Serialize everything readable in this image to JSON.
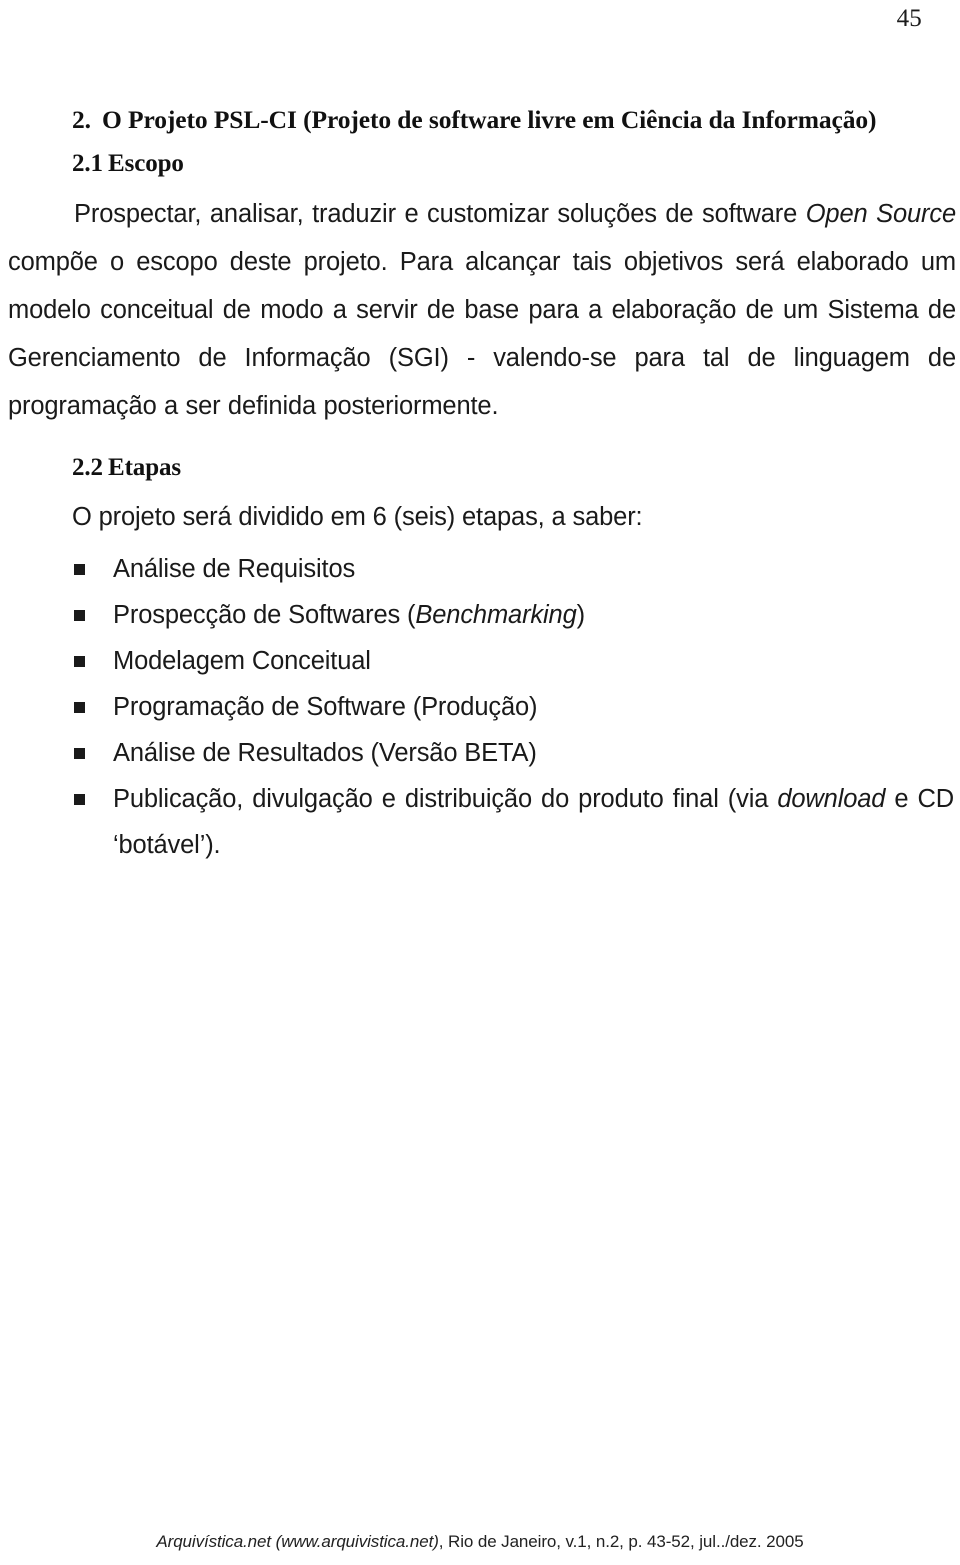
{
  "document": {
    "page_number": "45",
    "section": {
      "number": "2.",
      "title": "O Projeto PSL-CI (Projeto de software livre em Ciência da Informação)"
    },
    "subsection_escopo": {
      "number": "2.1",
      "title": "Escopo",
      "paragraph": {
        "part1": "Prospectar, analisar, traduzir e customizar soluções de software ",
        "italic1": "Open Source",
        "part2": " compõe o escopo deste projeto. Para alcançar tais objetivos será elaborado um modelo conceitual de modo a servir de base para a elaboração de um Sistema de Gerenciamento de Informação (SGI) - valendo-se para tal de linguagem de programação a ser definida posteriormente."
      }
    },
    "subsection_etapas": {
      "number": "2.2",
      "title": "Etapas",
      "intro": "O projeto será dividido em 6 (seis) etapas, a saber:",
      "items": [
        {
          "text_before": "Análise de Requisitos",
          "italic": "",
          "text_after": ""
        },
        {
          "text_before": "Prospecção de Softwares (",
          "italic": "Benchmarking",
          "text_after": ")"
        },
        {
          "text_before": "Modelagem Conceitual",
          "italic": "",
          "text_after": ""
        },
        {
          "text_before": "Programação de Software (Produção)",
          "italic": "",
          "text_after": ""
        },
        {
          "text_before": "Análise de Resultados (Versão BETA)",
          "italic": "",
          "text_after": ""
        },
        {
          "text_before": "Publicação, divulgação e distribuição do produto final (via ",
          "italic": "download",
          "text_after": " e CD ‘botável’)."
        }
      ]
    },
    "footer": {
      "journal": "Arquivística.net (www.arquivistica.net)",
      "citation": ", Rio de Janeiro, v.1, n.2, p. 43-52, jul../dez. 2005"
    }
  }
}
